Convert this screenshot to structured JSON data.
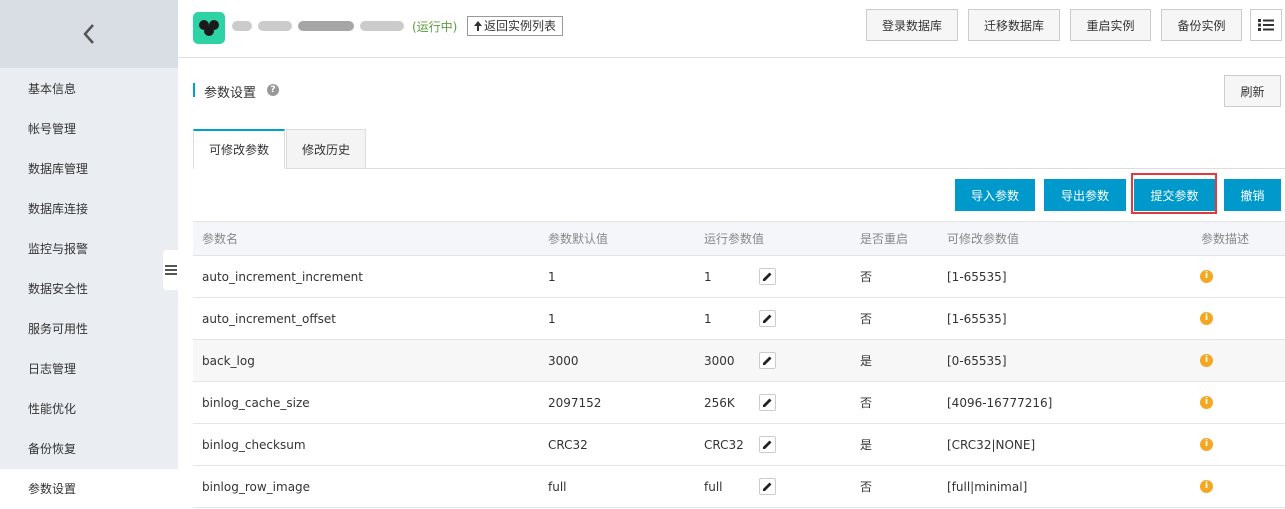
{
  "sidebar": {
    "items": [
      {
        "label": "基本信息"
      },
      {
        "label": "帐号管理"
      },
      {
        "label": "数据库管理"
      },
      {
        "label": "数据库连接"
      },
      {
        "label": "监控与报警"
      },
      {
        "label": "数据安全性"
      },
      {
        "label": "服务可用性"
      },
      {
        "label": "日志管理"
      },
      {
        "label": "性能优化"
      },
      {
        "label": "备份恢复"
      },
      {
        "label": "参数设置"
      }
    ],
    "active_index": 10
  },
  "header": {
    "status": "(运行中)",
    "back_to_list": "返回实例列表",
    "buttons": {
      "login_db": "登录数据库",
      "migrate_db": "迁移数据库",
      "restart": "重启实例",
      "backup": "备份实例"
    }
  },
  "section": {
    "title": "参数设置",
    "refresh": "刷新"
  },
  "tabs": {
    "editable": "可修改参数",
    "history": "修改历史"
  },
  "actions": {
    "import": "导入参数",
    "export": "导出参数",
    "submit": "提交参数",
    "cancel": "撤销"
  },
  "table": {
    "headers": {
      "name": "参数名",
      "default": "参数默认值",
      "running": "运行参数值",
      "restart": "是否重启",
      "range": "可修改参数值",
      "desc": "参数描述"
    },
    "rows": [
      {
        "name": "auto_increment_increment",
        "default": "1",
        "running": "1",
        "restart": "否",
        "range": "[1-65535]"
      },
      {
        "name": "auto_increment_offset",
        "default": "1",
        "running": "1",
        "restart": "否",
        "range": "[1-65535]"
      },
      {
        "name": "back_log",
        "default": "3000",
        "running": "3000",
        "restart": "是",
        "range": "[0-65535]"
      },
      {
        "name": "binlog_cache_size",
        "default": "2097152",
        "running": "256K",
        "restart": "否",
        "range": "[4096-16777216]"
      },
      {
        "name": "binlog_checksum",
        "default": "CRC32",
        "running": "CRC32",
        "restart": "是",
        "range": "[CRC32|NONE]"
      },
      {
        "name": "binlog_row_image",
        "default": "full",
        "running": "full",
        "restart": "否",
        "range": "[full|minimal]"
      }
    ]
  }
}
